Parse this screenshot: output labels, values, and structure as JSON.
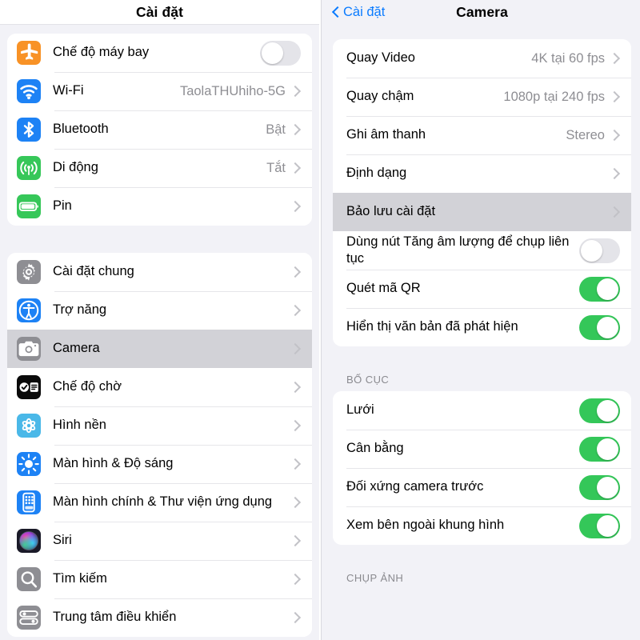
{
  "sidebar": {
    "title": "Cài đặt",
    "group1": [
      {
        "label": "Chế độ máy bay",
        "icon": "airplane-icon",
        "color": "#f89226",
        "accessory": "toggle",
        "toggle_on": false
      },
      {
        "label": "Wi-Fi",
        "icon": "wifi-icon",
        "color": "#1d82f5",
        "accessory": "value",
        "value": "TaolaTHUhiho-5G"
      },
      {
        "label": "Bluetooth",
        "icon": "bluetooth-icon",
        "color": "#1d82f5",
        "accessory": "value",
        "value": "Bật"
      },
      {
        "label": "Di động",
        "icon": "cellular-icon",
        "color": "#36c759",
        "accessory": "value",
        "value": "Tắt"
      },
      {
        "label": "Pin",
        "icon": "battery-icon",
        "color": "#36c759",
        "accessory": "chevron",
        "value": ""
      }
    ],
    "group2": [
      {
        "label": "Cài đặt chung",
        "icon": "gear-icon",
        "color": "#8e8e93",
        "selected": false
      },
      {
        "label": "Trợ năng",
        "icon": "accessibility-icon",
        "color": "#1d82f5",
        "selected": false
      },
      {
        "label": "Camera",
        "icon": "camera-icon",
        "color": "#8e8e93",
        "selected": true
      },
      {
        "label": "Chế độ chờ",
        "icon": "standby-icon",
        "color": "#0a0a0a",
        "selected": false
      },
      {
        "label": "Hình nền",
        "icon": "wallpaper-icon",
        "color": "#4ab8e8",
        "selected": false
      },
      {
        "label": "Màn hình & Độ sáng",
        "icon": "brightness-icon",
        "color": "#1d82f5",
        "selected": false
      },
      {
        "label": "Màn hình chính & Thư viện ứng dụng",
        "icon": "homescreen-icon",
        "color": "#1d82f5",
        "selected": false
      },
      {
        "label": "Siri",
        "icon": "siri-icon",
        "color": "#2a2a35",
        "selected": false
      },
      {
        "label": "Tìm kiếm",
        "icon": "search-icon",
        "color": "#8e8e93",
        "selected": false
      },
      {
        "label": "Trung tâm điều khiển",
        "icon": "control-center-icon",
        "color": "#8e8e93",
        "selected": false
      }
    ]
  },
  "detail": {
    "back_label": "Cài đặt",
    "title": "Camera",
    "group1": [
      {
        "label": "Quay Video",
        "accessory": "value",
        "value": "4K tại 60 fps",
        "selected": false
      },
      {
        "label": "Quay chậm",
        "accessory": "value",
        "value": "1080p tại 240 fps",
        "selected": false
      },
      {
        "label": "Ghi âm thanh",
        "accessory": "value",
        "value": "Stereo",
        "selected": false
      },
      {
        "label": "Định dạng",
        "accessory": "chevron",
        "value": "",
        "selected": false
      },
      {
        "label": "Bảo lưu cài đặt",
        "accessory": "chevron",
        "value": "",
        "selected": true
      },
      {
        "label": "Dùng nút Tăng âm lượng để chụp liên tục",
        "accessory": "toggle",
        "toggle_on": false,
        "selected": false
      },
      {
        "label": "Quét mã QR",
        "accessory": "toggle",
        "toggle_on": true,
        "selected": false
      },
      {
        "label": "Hiển thị văn bản đã phát hiện",
        "accessory": "toggle",
        "toggle_on": true,
        "selected": false
      }
    ],
    "section2_title": "BỐ CỤC",
    "group2": [
      {
        "label": "Lưới",
        "accessory": "toggle",
        "toggle_on": true
      },
      {
        "label": "Cân bằng",
        "accessory": "toggle",
        "toggle_on": true
      },
      {
        "label": "Đối xứng camera trước",
        "accessory": "toggle",
        "toggle_on": true
      },
      {
        "label": "Xem bên ngoài khung hình",
        "accessory": "toggle",
        "toggle_on": true
      }
    ],
    "section3_title": "CHỤP ẢNH"
  },
  "colors": {
    "accent": "#0a7bff",
    "toggle_on": "#34c759",
    "selected_row": "#d2d2d7",
    "page_bg": "#f2f2f7"
  }
}
